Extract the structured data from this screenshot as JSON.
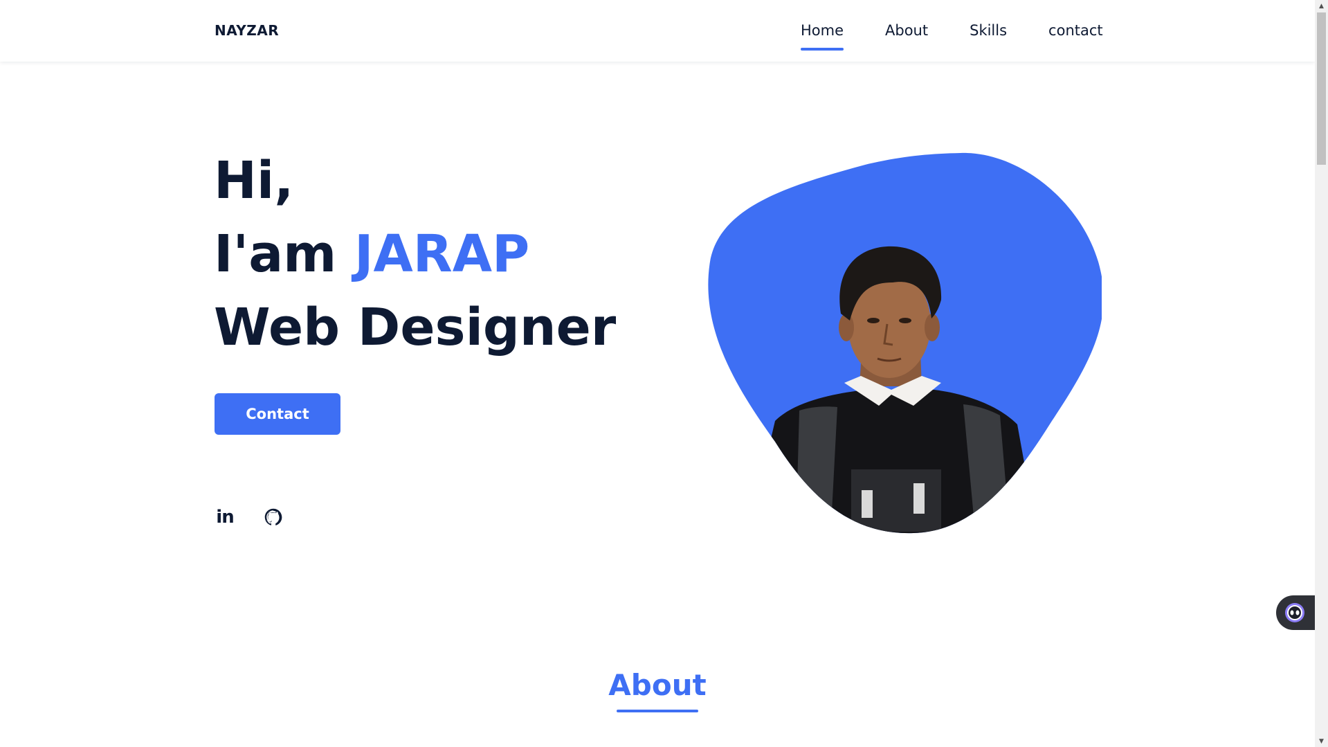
{
  "header": {
    "logo": "NAYZAR",
    "nav": [
      "Home",
      "About",
      "Skills",
      "contact"
    ],
    "active_nav": "Home"
  },
  "hero": {
    "greeting": "Hi,",
    "intro_prefix": "I'am ",
    "name": "JARAP",
    "role": "Web Designer",
    "contact_button": "Contact"
  },
  "social": {
    "linkedin_icon": "linkedin-icon",
    "linkedin_glyph": "in",
    "github_icon": "github-icon"
  },
  "sections": {
    "about_title": "About"
  },
  "colors": {
    "accent": "#3e6ff4",
    "text": "#0e1a33",
    "widget": "#2f3137"
  },
  "widgets": {
    "assistant_icon": "assistant-face-icon"
  }
}
